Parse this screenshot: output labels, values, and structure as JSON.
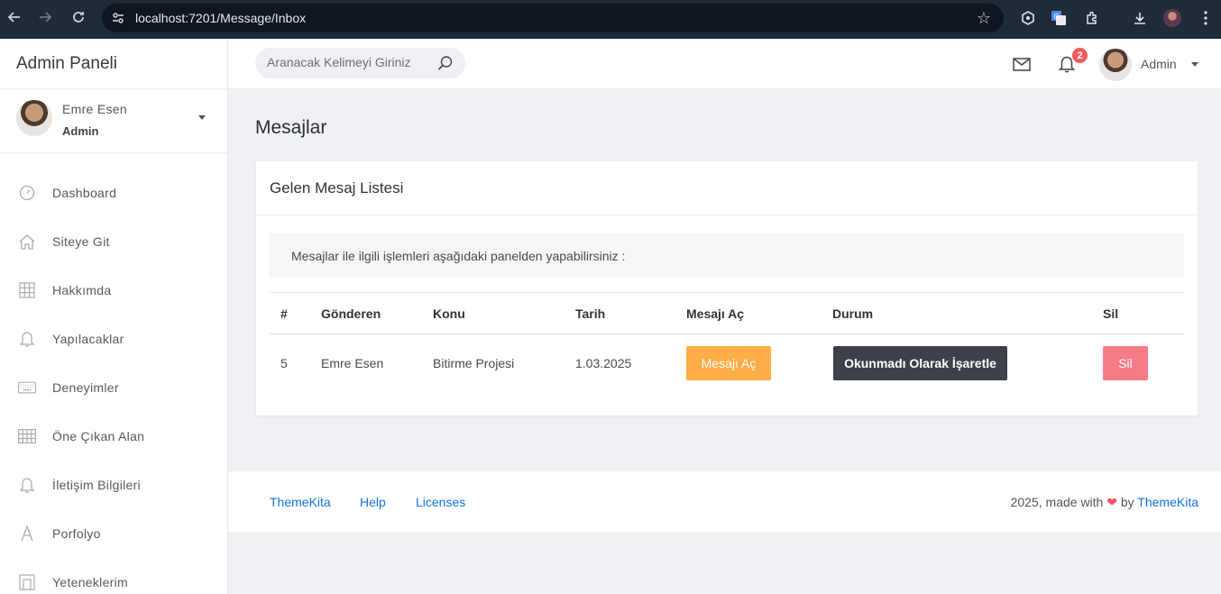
{
  "browser": {
    "url": "localhost:7201/Message/Inbox"
  },
  "sidebar": {
    "brand": "Admin Paneli",
    "user": {
      "name": "Emre Esen",
      "role": "Admin"
    },
    "items": [
      {
        "label": "Dashboard",
        "icon": "speedometer-icon"
      },
      {
        "label": "Siteye Git",
        "icon": "home-icon"
      },
      {
        "label": "Hakkımda",
        "icon": "grid-icon"
      },
      {
        "label": "Yapılacaklar",
        "icon": "bell-icon"
      },
      {
        "label": "Deneyimler",
        "icon": "keyboard-icon"
      },
      {
        "label": "Öne Çıkan Alan",
        "icon": "grid-icon"
      },
      {
        "label": "İletişim Bilgileri",
        "icon": "bell-icon"
      },
      {
        "label": "Porfolyo",
        "icon": "letter-a-icon"
      },
      {
        "label": "Yeteneklerim",
        "icon": "building-icon"
      }
    ]
  },
  "topbar": {
    "search_placeholder": "Aranacak Kelimeyi Giriniz",
    "notification_count": "2",
    "user_label": "Admin"
  },
  "main": {
    "page_title": "Mesajlar",
    "card_title": "Gelen Mesaj Listesi",
    "info_text": "Mesajlar ile ilgili işlemleri aşağıdaki panelden yapabilirsiniz :",
    "table": {
      "headers": [
        "#",
        "Gönderen",
        "Konu",
        "Tarih",
        "Mesajı Aç",
        "Durum",
        "Sil"
      ],
      "rows": [
        {
          "id": "5",
          "sender": "Emre Esen",
          "subject": "Bitirme Projesi",
          "date": "1.03.2025",
          "open_label": "Mesajı Aç",
          "status_label": "Okunmadı Olarak İşaretle",
          "delete_label": "Sil"
        }
      ]
    }
  },
  "footer": {
    "links": [
      "ThemeKita",
      "Help",
      "Licenses"
    ],
    "copy_prefix": "2025, made with",
    "copy_by": "by",
    "copy_brand": "ThemeKita"
  },
  "colors": {
    "warning": "#ffad46",
    "dark": "#3d4148",
    "danger": "#f77b86",
    "link": "#1572e8",
    "badge": "#f25961"
  }
}
